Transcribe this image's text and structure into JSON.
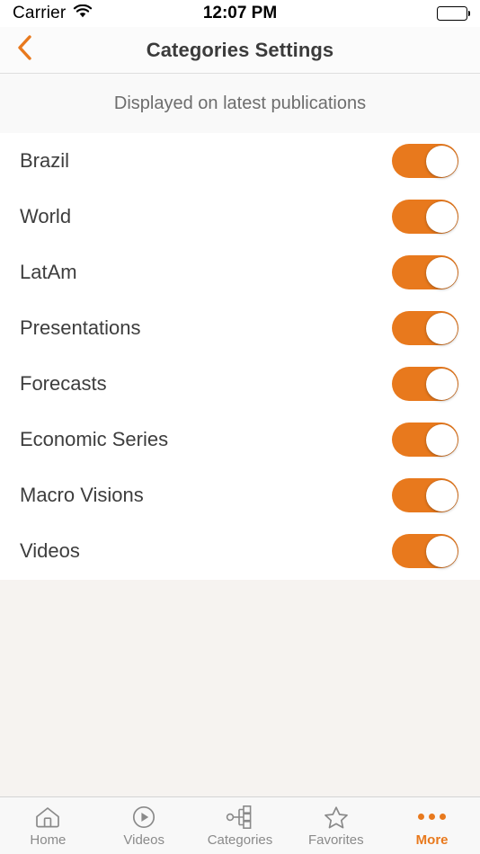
{
  "status_bar": {
    "carrier": "Carrier",
    "wifi_icon": "wifi-icon",
    "time": "12:07 PM",
    "battery_icon": "battery-full-icon"
  },
  "nav_bar": {
    "back_icon": "chevron-left-icon",
    "title": "Categories Settings"
  },
  "section": {
    "header": "Displayed on latest publications"
  },
  "categories": [
    {
      "label": "Brazil",
      "enabled": true
    },
    {
      "label": "World",
      "enabled": true
    },
    {
      "label": "LatAm",
      "enabled": true
    },
    {
      "label": "Presentations",
      "enabled": true
    },
    {
      "label": "Forecasts",
      "enabled": true
    },
    {
      "label": "Economic Series",
      "enabled": true
    },
    {
      "label": "Macro Visions",
      "enabled": true
    },
    {
      "label": "Videos",
      "enabled": true
    }
  ],
  "tab_bar": {
    "items": [
      {
        "label": "Home",
        "icon": "house-icon",
        "active": false
      },
      {
        "label": "Videos",
        "icon": "play-circle-icon",
        "active": false
      },
      {
        "label": "Categories",
        "icon": "node-tree-icon",
        "active": false
      },
      {
        "label": "Favorites",
        "icon": "star-icon",
        "active": false
      },
      {
        "label": "More",
        "icon": "ellipsis-icon",
        "active": true
      }
    ]
  },
  "colors": {
    "accent": "#e8791d",
    "text_primary": "#3d3d3d",
    "text_secondary": "#6d6d6d",
    "tab_inactive": "#8a8a8a",
    "content_background": "#f6f3f0"
  }
}
